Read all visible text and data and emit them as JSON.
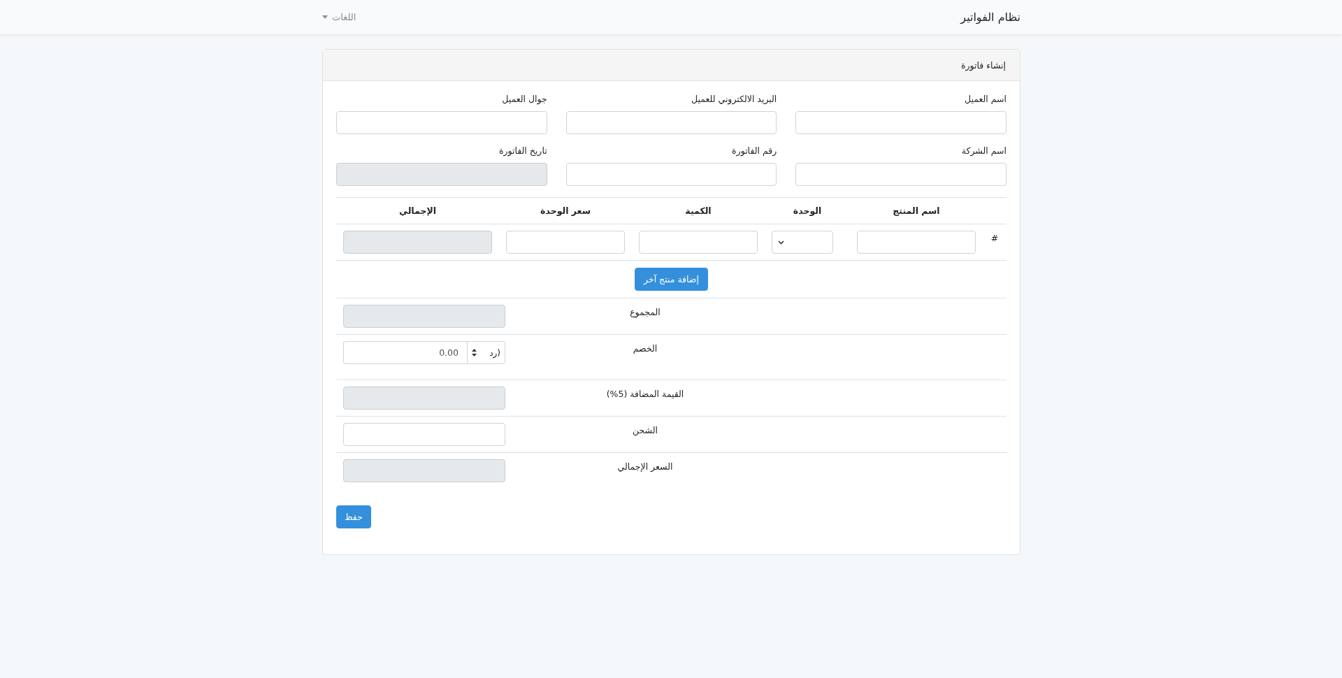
{
  "navbar": {
    "brand": "نظام الفواتير",
    "languages_menu": "اللغات"
  },
  "card": {
    "title": "إنشاء فاتورة",
    "fields": [
      {
        "label": "اسم العميل",
        "disabled": false
      },
      {
        "label": "البريد الالكتروني للعميل",
        "disabled": false
      },
      {
        "label": "جوال العميل",
        "disabled": false
      },
      {
        "label": "اسم الشركة",
        "disabled": false
      },
      {
        "label": "رقم الفاتورة",
        "disabled": false
      },
      {
        "label": "تاريخ الفاتورة",
        "disabled": true
      }
    ],
    "items_table": {
      "columns": [
        "",
        "اسم المنتج",
        "الوحدة",
        "الكمية",
        "سعر الوحدة",
        "الإجمالي"
      ],
      "rows": [
        {
          "number": "#",
          "cells": [
            {
              "kind": "input",
              "disabled": false
            },
            {
              "kind": "select",
              "disabled": false
            },
            {
              "kind": "input",
              "disabled": false
            },
            {
              "kind": "input",
              "disabled": false
            },
            {
              "kind": "input",
              "disabled": true
            }
          ]
        }
      ]
    },
    "add_product_button": "إضافة منتج آخر",
    "totals": [
      {
        "label": "المجموع",
        "kind": "input",
        "disabled": true
      },
      {
        "label": "الخصم",
        "kind": "discount",
        "disabled": false,
        "value": "0.00",
        "unit": "(رد"
      },
      {
        "label": "القيمة المضافة (5%)",
        "kind": "input",
        "disabled": true
      },
      {
        "label": "الشحن",
        "kind": "input",
        "disabled": false
      },
      {
        "label": "السعر الإجمالي",
        "kind": "input",
        "disabled": true
      }
    ],
    "save_button": "حفظ"
  }
}
